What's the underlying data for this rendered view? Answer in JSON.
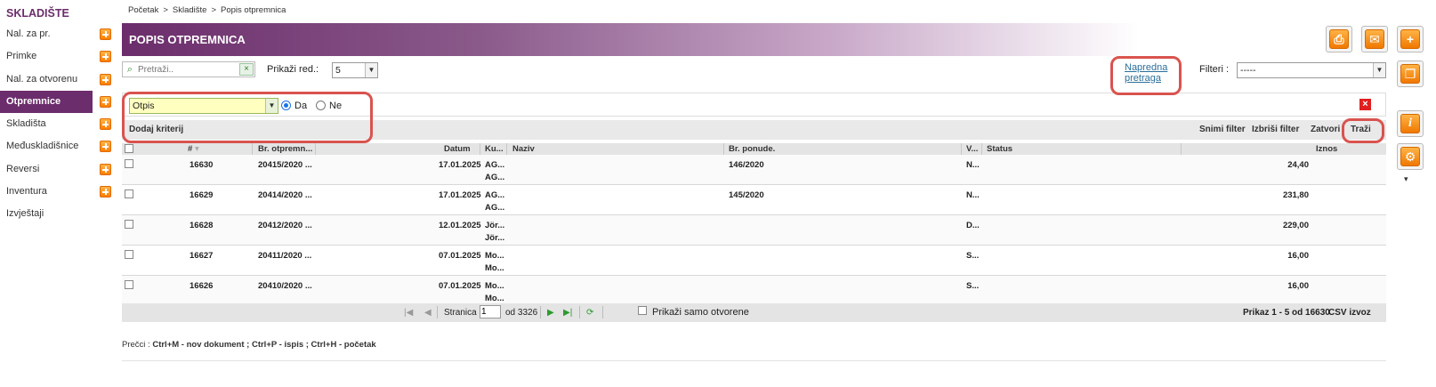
{
  "sidebar": {
    "title": "SKLADIŠTE",
    "items": [
      {
        "label": "Nal. za pr.",
        "add": true
      },
      {
        "label": "Primke",
        "add": true
      },
      {
        "label": "Nal. za otvorenu",
        "add": true
      },
      {
        "label": "Otpremnice",
        "add": true,
        "active": true
      },
      {
        "label": "Skladišta",
        "add": true
      },
      {
        "label": "Međuskladišnice",
        "add": true
      },
      {
        "label": "Reversi",
        "add": true
      },
      {
        "label": "Inventura",
        "add": true
      },
      {
        "label": "Izvještaji",
        "add": false
      }
    ]
  },
  "breadcrumb": {
    "items": [
      "Početak",
      "Skladište",
      "Popis otpremnica"
    ],
    "sep": ">"
  },
  "header": {
    "title": "POPIS OTPREMNICA"
  },
  "toolbar": {
    "search_placeholder": "Pretraži..",
    "rows_label": "Prikaži red.:",
    "rows_value": "5",
    "advanced_search_line1": "Napredna",
    "advanced_search_line2": "pretraga",
    "filters_label": "Filteri :",
    "filters_value": "-----"
  },
  "filter_panel": {
    "field_value": "Otpis",
    "radio_yes": "Da",
    "radio_no": "Ne",
    "selected": "Da",
    "add_criteria": "Dodaj kriterij",
    "save_filter": "Snimi filter",
    "delete_filter": "Izbriši filter",
    "close": "Zatvori",
    "search": "Traži"
  },
  "table": {
    "columns": [
      "#",
      "Br. otpremn...",
      "Datum",
      "Ku...",
      "Naziv",
      "Br. ponude.",
      "V...",
      "Status",
      "Iznos"
    ],
    "rows": [
      {
        "id": "16630",
        "doc": "20415/2020 ...",
        "date": "17.01.2025",
        "cust1": "AG...",
        "cust2": "AG...",
        "offer": "146/2020",
        "v": "N...",
        "amount": "24,40"
      },
      {
        "id": "16629",
        "doc": "20414/2020 ...",
        "date": "17.01.2025",
        "cust1": "AG...",
        "cust2": "AG...",
        "offer": "145/2020",
        "v": "N...",
        "amount": "231,80"
      },
      {
        "id": "16628",
        "doc": "20412/2020 ...",
        "date": "12.01.2025",
        "cust1": "Jör...",
        "cust2": "Jör...",
        "offer": "",
        "v": "D...",
        "amount": "229,00"
      },
      {
        "id": "16627",
        "doc": "20411/2020 ...",
        "date": "07.01.2025",
        "cust1": "Mo...",
        "cust2": "Mo...",
        "offer": "",
        "v": "S...",
        "amount": "16,00"
      },
      {
        "id": "16626",
        "doc": "20410/2020 ...",
        "date": "07.01.2025",
        "cust1": "Mo...",
        "cust2": "Mo...",
        "offer": "",
        "v": "S...",
        "amount": "16,00"
      }
    ]
  },
  "pager": {
    "page_label": "Stranica",
    "page_value": "1",
    "of_label": "od 3326",
    "only_open_label": "Prikaži samo otvorene",
    "summary": "Prikaz 1 - 5 od 16630",
    "csv": "CSV izvoz"
  },
  "shortcuts": {
    "prefix": "Prečci :",
    "text": "Ctrl+M - nov dokument ;  Ctrl+P - ispis ;  Ctrl+H - početak"
  },
  "icons": {
    "print": "printer-icon",
    "mail": "envelope-icon",
    "add": "plus-icon",
    "copy": "copy-icon",
    "info": "info-icon",
    "settings": "gear-icon"
  },
  "colors": {
    "brand": "#6b2d6b",
    "accent": "#f07800",
    "highlight": "#d9534f"
  }
}
